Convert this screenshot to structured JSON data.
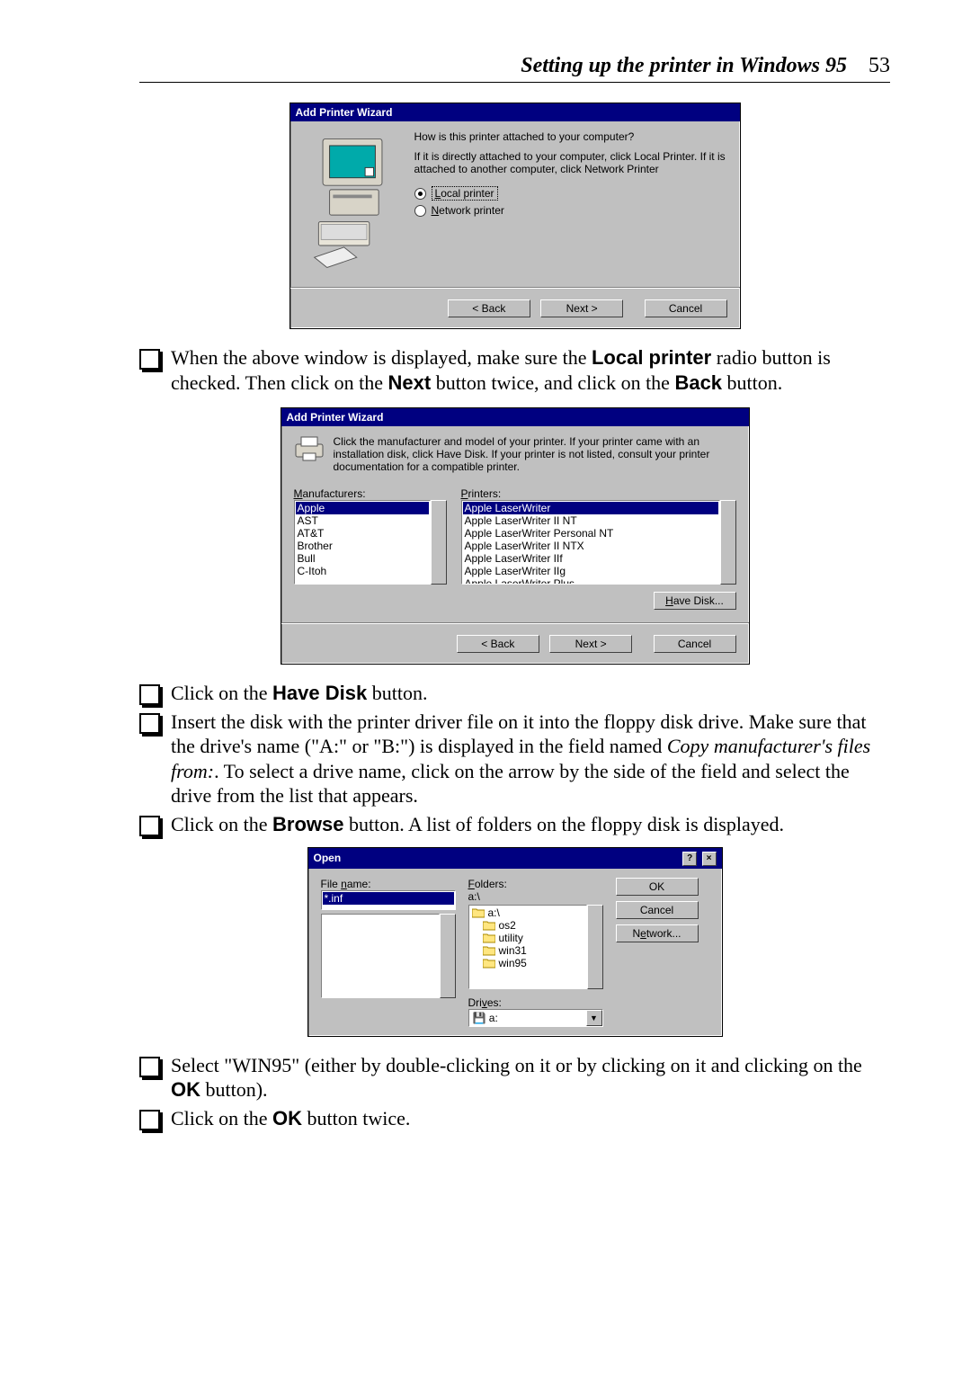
{
  "header": {
    "title": "Setting up the printer in Windows 95",
    "page_number": "53"
  },
  "dlg1": {
    "title": "Add Printer Wizard",
    "question": "How is this printer attached to your computer?",
    "explain": "If it is directly attached to your computer, click Local Printer. If it is attached to another computer, click Network Printer",
    "opt_local": "Local printer",
    "opt_network": "Network printer",
    "back": "< Back",
    "next": "Next >",
    "cancel": "Cancel"
  },
  "para1_a": "When the above window  is displayed, make sure the ",
  "para1_b": "Local printer",
  "para1_c": " radio button is checked. Then click on the ",
  "para1_d": "Next",
  "para1_e": " button twice, and click on the ",
  "para1_f": "Back",
  "para1_g": " button.",
  "dlg2": {
    "title": "Add Printer Wizard",
    "instr": "Click the manufacturer and model of your printer. If your printer came with an installation disk, click Have Disk. If your printer is not listed, consult your printer documentation for a compatible printer.",
    "mfr_label": "Manufacturers:",
    "prn_label": "Printers:",
    "mfrs": [
      "Apple",
      "AST",
      "AT&T",
      "Brother",
      "Bull",
      "C-Itoh"
    ],
    "prns": [
      "Apple LaserWriter",
      "Apple LaserWriter II NT",
      "Apple LaserWriter Personal NT",
      "Apple LaserWriter II NTX",
      "Apple LaserWriter IIf",
      "Apple LaserWriter IIg",
      "Apple LaserWriter Plus"
    ],
    "have_disk": "Have Disk...",
    "back": "< Back",
    "next": "Next >",
    "cancel": "Cancel"
  },
  "para2_a": "Click on the ",
  "para2_b": "Have Disk",
  "para2_c": " button.",
  "para3_a": "Insert the disk with the printer driver file on it into the floppy disk drive. Make sure that the drive's name (\"A:\" or \"B:\") is displayed in the field named ",
  "para3_b": "Copy manufacturer's files from:",
  "para3_c": ". To select a drive name, click on the arrow by the side of the field and select the drive from the list that appears.",
  "para4_a": "Click on the ",
  "para4_b": "Browse",
  "para4_c": " button. A list of folders on the floppy disk is displayed.",
  "dlg3": {
    "title": "Open",
    "filename_label": "File name:",
    "filename_value": "*.inf",
    "folders_label": "Folders:",
    "folders_path": "a:\\",
    "folders": [
      "a:\\",
      "os2",
      "utility",
      "win31",
      "win95"
    ],
    "drives_label": "Drives:",
    "drives_value": "a:",
    "ok": "OK",
    "cancel": "Cancel",
    "network": "Network..."
  },
  "para5_a": "Select \"WIN95\" (either by double-clicking on it or by clicking on it and clicking on the ",
  "para5_b": "OK",
  "para5_c": " button).",
  "para6_a": "Click on the ",
  "para6_b": "OK",
  "para6_c": " button twice."
}
